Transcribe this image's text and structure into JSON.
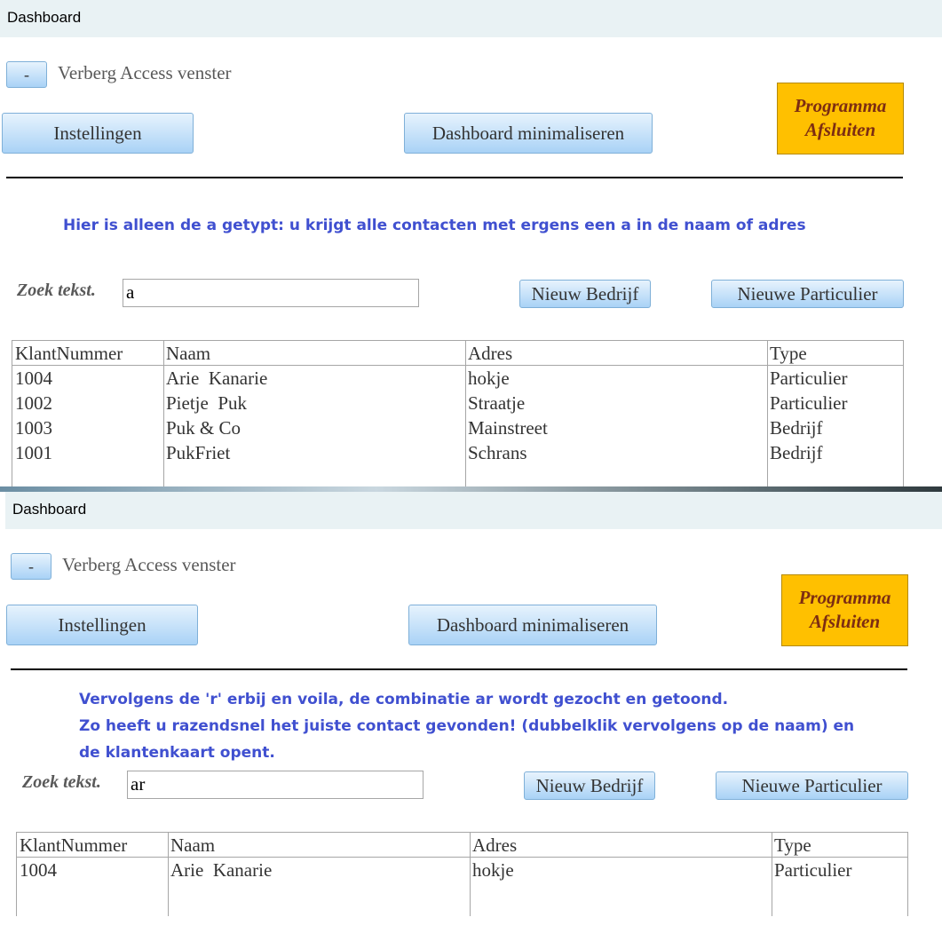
{
  "panels": [
    {
      "title": "Dashboard",
      "hide_btn": "-",
      "hide_label": "Verberg Access venster",
      "settings_btn": "Instellingen",
      "minimize_btn": "Dashboard minimaliseren",
      "exit_btn_line1": "Programma",
      "exit_btn_line2": "Afsluiten",
      "note_lines": [
        "Hier is alleen de a getypt: u krijgt alle contacten met ergens een a in de naam of adres"
      ],
      "search_label": "Zoek tekst.",
      "search_value": "a",
      "new_company_btn": "Nieuw Bedrijf",
      "new_private_btn": "Nieuwe Particulier",
      "table": {
        "headers": [
          "KlantNummer",
          "Naam",
          "Adres",
          "Type"
        ],
        "rows": [
          [
            "1004",
            "Arie  Kanarie",
            "hokje",
            "Particulier"
          ],
          [
            "1002",
            "Pietje  Puk",
            "Straatje",
            "Particulier"
          ],
          [
            "1003",
            "Puk & Co",
            "Mainstreet",
            "Bedrijf"
          ],
          [
            "1001",
            "PukFriet",
            "Schrans",
            "Bedrijf"
          ]
        ]
      }
    },
    {
      "title": "Dashboard",
      "hide_btn": "-",
      "hide_label": "Verberg Access venster",
      "settings_btn": "Instellingen",
      "minimize_btn": "Dashboard minimaliseren",
      "exit_btn_line1": "Programma",
      "exit_btn_line2": "Afsluiten",
      "note_lines": [
        "Vervolgens de 'r' erbij en voila, de combinatie ar wordt gezocht en getoond.",
        "Zo heeft u razendsnel het juiste contact gevonden! (dubbelklik vervolgens op de naam) en",
        "de klantenkaart opent."
      ],
      "search_label": "Zoek tekst.",
      "search_value": "ar",
      "new_company_btn": "Nieuw Bedrijf",
      "new_private_btn": "Nieuwe Particulier",
      "table": {
        "headers": [
          "KlantNummer",
          "Naam",
          "Adres",
          "Type"
        ],
        "rows": [
          [
            "1004",
            "Arie  Kanarie",
            "hokje",
            "Particulier"
          ]
        ]
      }
    }
  ]
}
